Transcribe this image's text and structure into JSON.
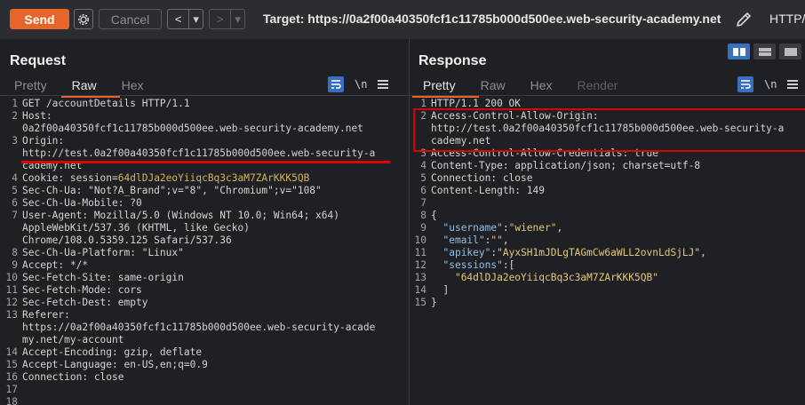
{
  "toolbar": {
    "send_label": "Send",
    "cancel_label": "Cancel",
    "back_glyph": "<",
    "forward_glyph": ">",
    "dropdown_glyph": "▾",
    "target_label": "Target: https://0a2f00a40350fcf1c11785b000d500ee.web-security-academy.net",
    "protocol_label": "HTTP/",
    "icons": [
      "gear-icon",
      "pencil-icon"
    ]
  },
  "layout_toggles": {
    "active": 0,
    "icons": [
      "split-columns-icon",
      "split-rows-icon",
      "single-pane-icon"
    ]
  },
  "request": {
    "title": "Request",
    "tabs": [
      "Pretty",
      "Raw",
      "Hex"
    ],
    "active_tab": "Raw",
    "icons": [
      "wrap-icon",
      "newline-icon",
      "menu-icon"
    ],
    "newline_glyph": "\\n",
    "lines": [
      {
        "n": "1",
        "text": "GET /accountDetails HTTP/1.1"
      },
      {
        "n": "2",
        "text": "Host:"
      },
      {
        "n": "",
        "text": "0a2f00a40350fcf1c11785b000d500ee.web-security-academy.net"
      },
      {
        "n": "3",
        "text": "Origin:"
      },
      {
        "n": "",
        "text": "http://test.0a2f00a40350fcf1c11785b000d500ee.web-security-a"
      },
      {
        "n": "",
        "text": "cademy.net"
      },
      {
        "n": "4",
        "text": "Cookie: session=",
        "value": "64dlDJa2eoYiiqcBq3c3aM7ZArKKK5QB"
      },
      {
        "n": "5",
        "text": "Sec-Ch-Ua: \"Not?A_Brand\";v=\"8\", \"Chromium\";v=\"108\""
      },
      {
        "n": "6",
        "text": "Sec-Ch-Ua-Mobile: ?0"
      },
      {
        "n": "7",
        "text": "User-Agent: Mozilla/5.0 (Windows NT 10.0; Win64; x64)"
      },
      {
        "n": "",
        "text": "AppleWebKit/537.36 (KHTML, like Gecko)"
      },
      {
        "n": "",
        "text": "Chrome/108.0.5359.125 Safari/537.36"
      },
      {
        "n": "8",
        "text": "Sec-Ch-Ua-Platform: \"Linux\""
      },
      {
        "n": "9",
        "text": "Accept: */*"
      },
      {
        "n": "10",
        "text": "Sec-Fetch-Site: same-origin"
      },
      {
        "n": "11",
        "text": "Sec-Fetch-Mode: cors"
      },
      {
        "n": "12",
        "text": "Sec-Fetch-Dest: empty"
      },
      {
        "n": "13",
        "text": "Referer:"
      },
      {
        "n": "",
        "text": "https://0a2f00a40350fcf1c11785b000d500ee.web-security-acade"
      },
      {
        "n": "",
        "text": "my.net/my-account"
      },
      {
        "n": "14",
        "text": "Accept-Encoding: gzip, deflate"
      },
      {
        "n": "15",
        "text": "Accept-Language: en-US,en;q=0.9"
      },
      {
        "n": "16",
        "text": "Connection: close"
      },
      {
        "n": "17",
        "text": ""
      },
      {
        "n": "18",
        "text": ""
      }
    ]
  },
  "response": {
    "title": "Response",
    "tabs": [
      "Pretty",
      "Raw",
      "Hex",
      "Render"
    ],
    "active_tab": "Pretty",
    "disabled_tab": "Render",
    "icons": [
      "wrap-icon",
      "newline-icon",
      "menu-icon"
    ],
    "newline_glyph": "\\n",
    "lines": [
      {
        "n": "1",
        "text": "HTTP/1.1 200 OK"
      },
      {
        "n": "2",
        "text": "Access-Control-Allow-Origin:"
      },
      {
        "n": "",
        "text": "http://test.0a2f00a40350fcf1c11785b000d500ee.web-security-a"
      },
      {
        "n": "",
        "text": "cademy.net"
      },
      {
        "n": "3",
        "text": "Access-Control-Allow-Credentials: true"
      },
      {
        "n": "4",
        "text": "Content-Type: application/json; charset=utf-8"
      },
      {
        "n": "5",
        "text": "Connection: close"
      },
      {
        "n": "6",
        "text": "Content-Length: 149"
      },
      {
        "n": "7",
        "text": ""
      },
      {
        "n": "8",
        "text": "{"
      },
      {
        "n": "9",
        "text": "  ",
        "key": "\"username\"",
        "sep": ":",
        "value": "\"wiener\"",
        "tail": ","
      },
      {
        "n": "10",
        "text": "  ",
        "key": "\"email\"",
        "sep": ":",
        "value": "\"\"",
        "tail": ","
      },
      {
        "n": "11",
        "text": "  ",
        "key": "\"apikey\"",
        "sep": ":",
        "value": "\"AyxSH1mJDLgTAGmCw6aWLL2ovnLdSjLJ\"",
        "tail": ","
      },
      {
        "n": "12",
        "text": "  ",
        "key": "\"sessions\"",
        "sep": ":[",
        "value": "",
        "tail": ""
      },
      {
        "n": "13",
        "text": "    ",
        "value": "\"64dlDJa2eoYiiqcBq3c3aM7ZArKKK5QB\""
      },
      {
        "n": "14",
        "text": "  ]"
      },
      {
        "n": "15",
        "text": "}"
      }
    ]
  },
  "colors": {
    "accent": "#e8652a",
    "highlight": "#e00000",
    "toggle_active": "#3a6fbf"
  }
}
